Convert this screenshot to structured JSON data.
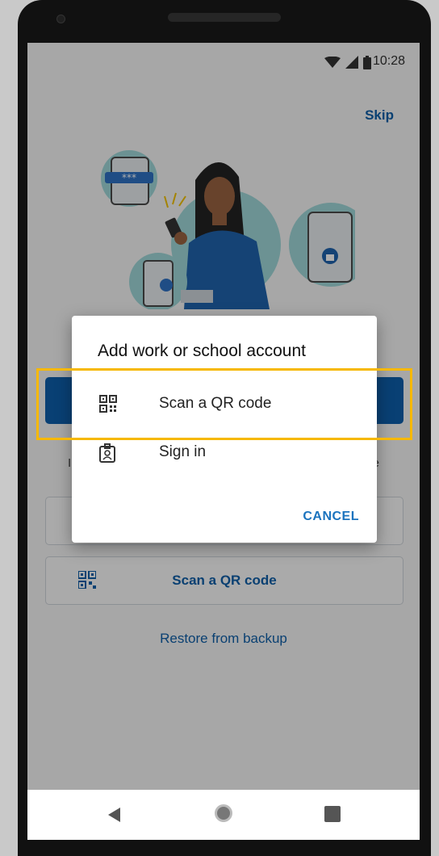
{
  "status_bar": {
    "time": "10:28",
    "icons": [
      "wifi-icon",
      "cell-signal-icon",
      "battery-icon"
    ]
  },
  "header": {
    "skip_label": "Skip"
  },
  "background_page": {
    "scan_qr_button_label": "Scan a QR code",
    "restore_link_label": "Restore from backup"
  },
  "dialog": {
    "title": "Add work or school account",
    "items": [
      {
        "label": "Scan a QR code",
        "icon": "qr-code-icon"
      },
      {
        "label": "Sign in",
        "icon": "id-badge-icon"
      }
    ],
    "cancel_label": "CANCEL"
  },
  "nav_bar": {
    "icons": [
      "back-icon",
      "home-icon",
      "recent-apps-icon"
    ]
  },
  "colors": {
    "accent_blue": "#0f5fa8",
    "highlight_yellow": "#f6b800"
  }
}
